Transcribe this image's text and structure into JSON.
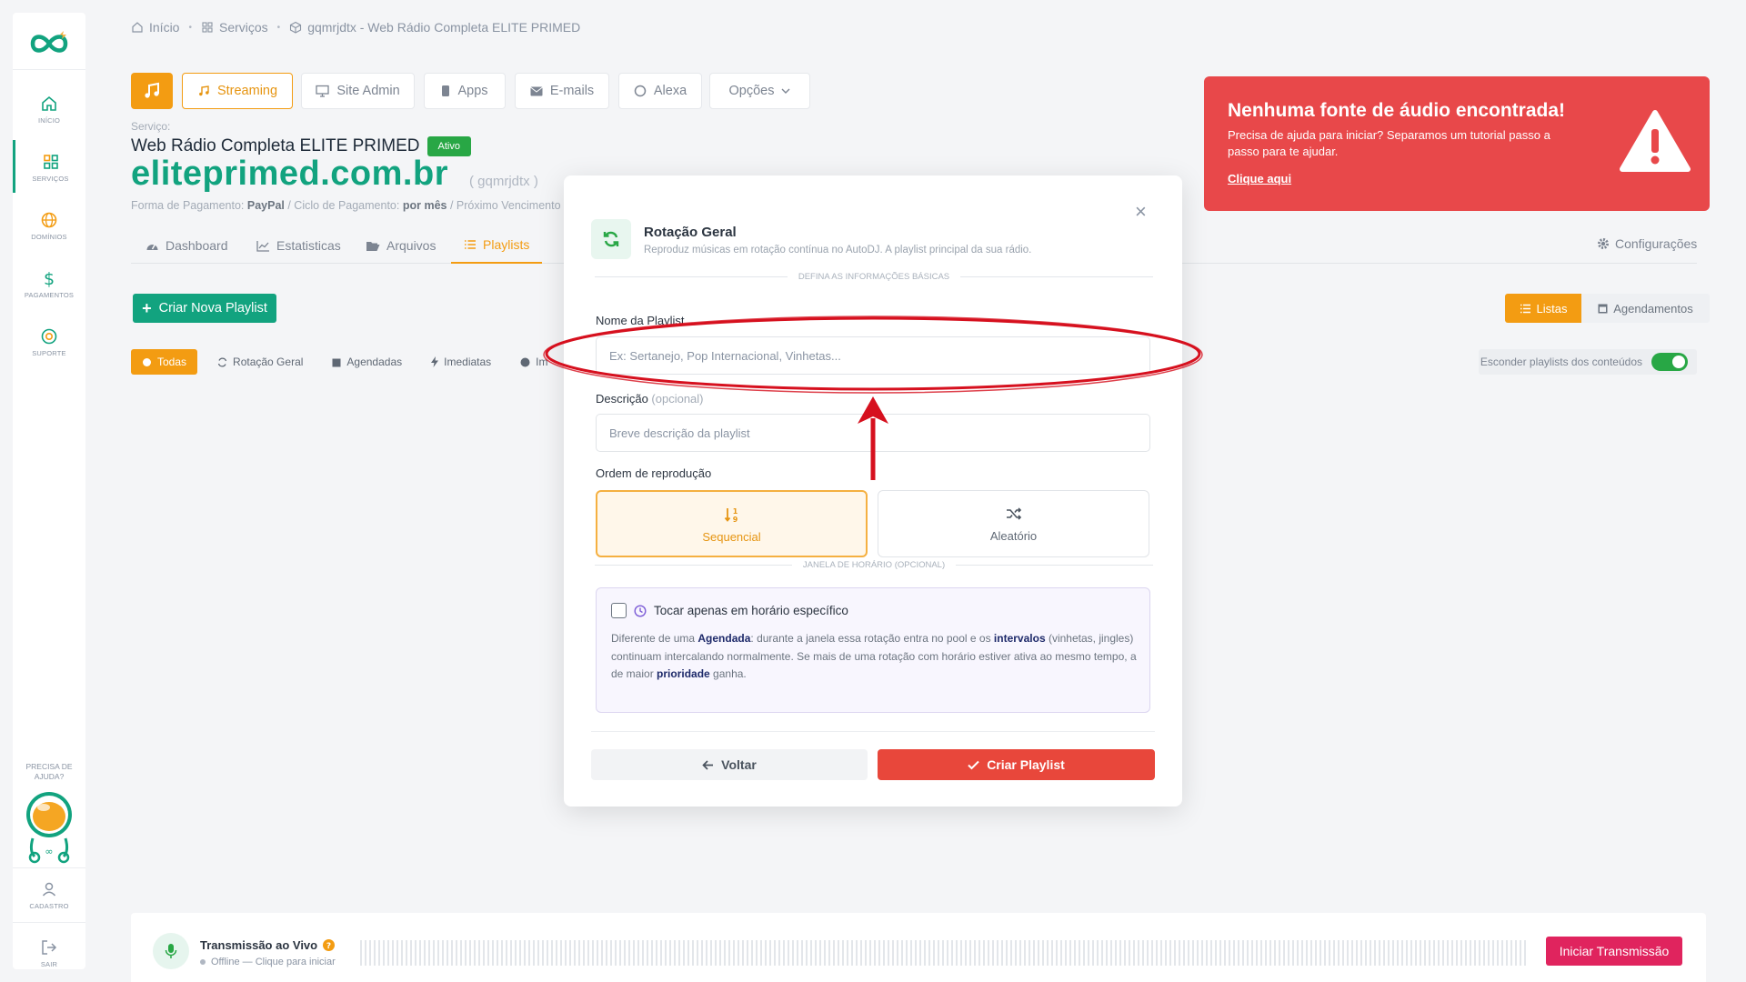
{
  "sidebar": {
    "items": [
      {
        "label": "INÍCIO",
        "icon": "home-icon"
      },
      {
        "label": "SERVIÇOS",
        "icon": "grid-icon"
      },
      {
        "label": "DOMÍNIOS",
        "icon": "globe-icon"
      },
      {
        "label": "PAGAMENTOS",
        "icon": "dollar-icon"
      },
      {
        "label": "SUPORTE",
        "icon": "lifebuoy-icon"
      }
    ],
    "help_label": "PRECISA DE AJUDA?",
    "bottom_items": [
      {
        "label": "CADASTRO",
        "icon": "user-icon"
      },
      {
        "label": "SAIR",
        "icon": "logout-icon"
      }
    ]
  },
  "breadcrumb": {
    "items": [
      "Início",
      "Serviços",
      "gqmrjdtx - Web Rádio Completa ELITE PRIMED"
    ]
  },
  "top_tabs": [
    "Streaming",
    "Site Admin",
    "Apps",
    "E-mails",
    "Alexa",
    "Opções"
  ],
  "service": {
    "label": "Serviço:",
    "name": "Web Rádio Completa ELITE PRIMED",
    "status": "Ativo",
    "domain": "eliteprimed.com.br",
    "id": "( gqmrjdtx )",
    "payment_label": "Forma de Pagamento:",
    "payment_value": "PayPal",
    "cycle_label": "/ Ciclo de Pagamento:",
    "cycle_value": "por mês",
    "next_label": "/ Próximo Vencimento"
  },
  "subnav": {
    "items": [
      "Dashboard",
      "Estatisticas",
      "Arquivos",
      "Playlists"
    ],
    "config": "Configurações"
  },
  "actions": {
    "new_playlist": "Criar Nova Playlist",
    "filters": [
      "Todas",
      "Rotação Geral",
      "Agendadas",
      "Imediatas",
      "Im"
    ],
    "view_lists": "Listas",
    "view_schedules": "Agendamentos",
    "hide_toggle_label": "Esconder playlists dos conteúdos"
  },
  "alert": {
    "title": "Nenhuma fonte de áudio encontrada!",
    "text": "Precisa de ajuda para iniciar? Separamos um tutorial passo a passo para te ajudar.",
    "link": "Clique aqui"
  },
  "live": {
    "title": "Transmissão ao Vivo",
    "status": "Offline — Clique para iniciar",
    "button": "Iniciar Transmissão"
  },
  "modal": {
    "close": "×",
    "title": "Rotação Geral",
    "subtitle": "Reproduz músicas em rotação contínua no AutoDJ. A playlist principal da sua rádio.",
    "section_basic": "DEFINA AS INFORMAÇÕES BÁSICAS",
    "name_label": "Nome da Playlist",
    "name_placeholder": "Ex: Sertanejo, Pop Internacional, Vinhetas...",
    "name_value": "",
    "desc_label": "Descrição",
    "desc_optional": "(opcional)",
    "desc_placeholder": "Breve descrição da playlist",
    "desc_value": "",
    "order_label": "Ordem de reprodução",
    "order_sequential": "Sequencial",
    "order_random": "Aleatório",
    "section_window": "JANELA DE HORÁRIO (OPCIONAL)",
    "window_check_label": "Tocar apenas em horário específico",
    "window_desc_1": "Diferente de uma ",
    "window_desc_b1": "Agendada",
    "window_desc_2": ": durante a janela essa rotação entra no pool e os ",
    "window_desc_b2": "intervalos",
    "window_desc_3": " (vinhetas, jingles) continuam intercalando normalmente. Se mais de uma rotação com horário estiver ativa ao mesmo tempo, a de maior ",
    "window_desc_b3": "prioridade",
    "window_desc_4": " ganha.",
    "back_button": "Voltar",
    "create_button": "Criar Playlist"
  },
  "colors": {
    "brand_green": "#12a37f",
    "accent_orange": "#f39c12",
    "alert_red": "#e8484a",
    "annotation_red": "#d6101e",
    "live_button": "#e0245e"
  }
}
